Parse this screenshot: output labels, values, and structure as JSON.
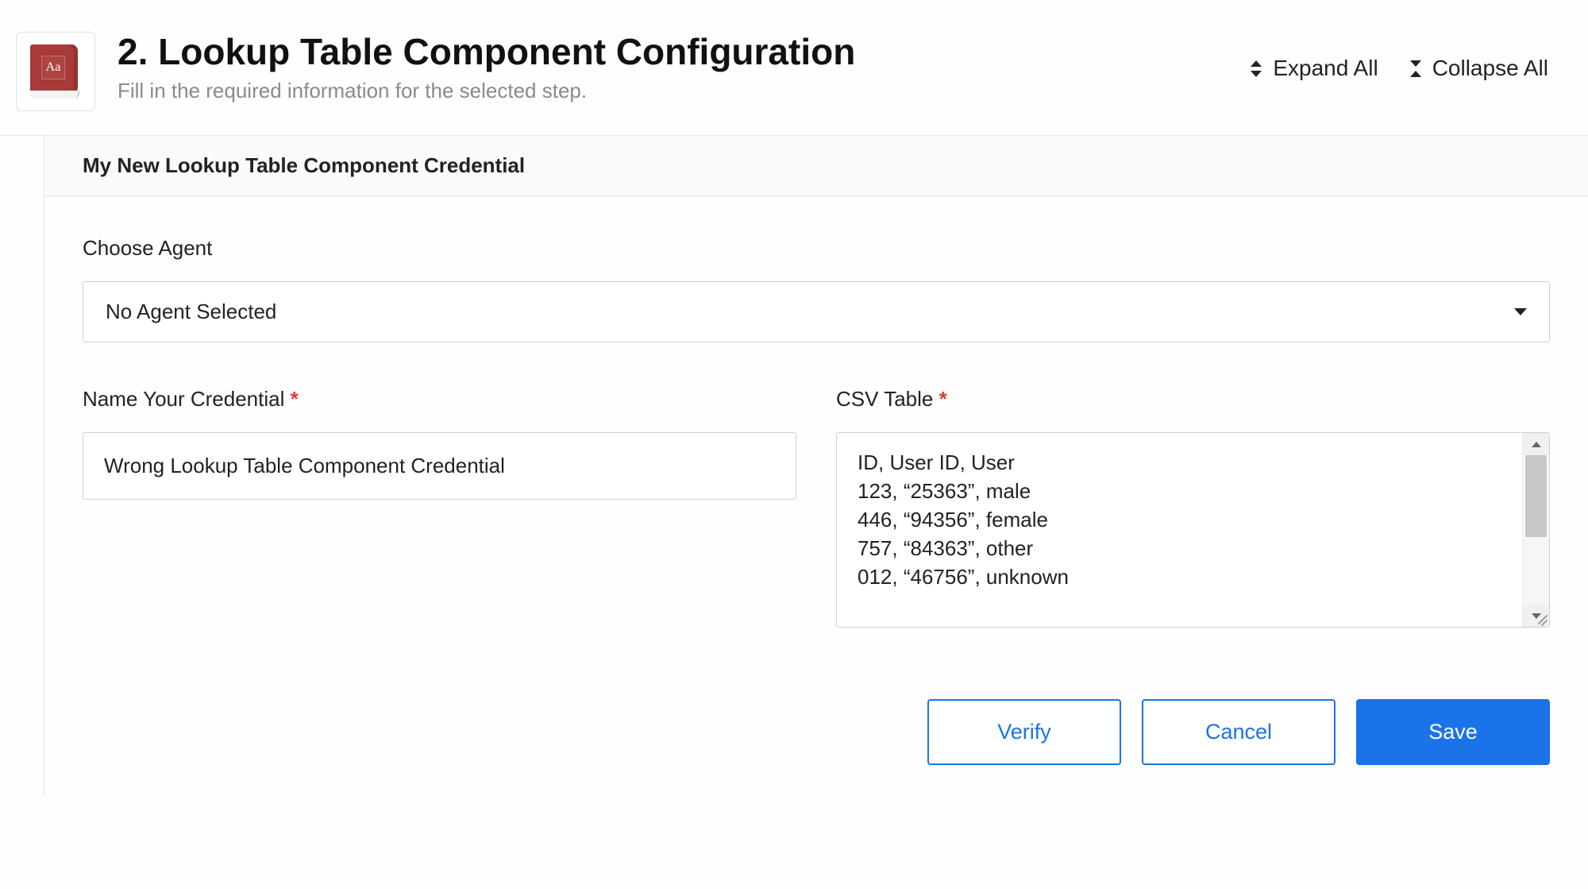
{
  "header": {
    "icon_letters": "Aa",
    "title": "2. Lookup Table Component Configuration",
    "subtitle": "Fill in the required information for the selected step.",
    "expand_label": "Expand All",
    "collapse_label": "Collapse All"
  },
  "panel": {
    "title": "My New Lookup Table Component Credential",
    "choose_agent_label": "Choose Agent",
    "agent_selected": "No Agent Selected",
    "name_label": "Name Your Credential",
    "name_value": "Wrong Lookup Table Component Credential",
    "csv_label": "CSV Table",
    "csv_value": "ID, User ID, User\n123, “25363”, male\n446, “94356”, female\n757, “84363”, other\n012, “46756”, unknown"
  },
  "actions": {
    "verify": "Verify",
    "cancel": "Cancel",
    "save": "Save"
  }
}
